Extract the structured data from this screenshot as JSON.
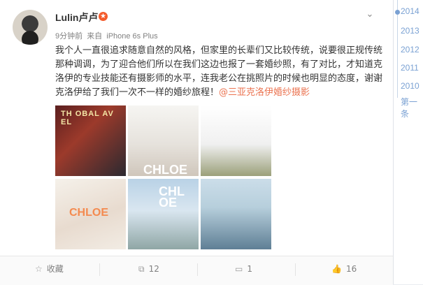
{
  "post": {
    "username": "Lulin卢卢",
    "vip_badge_icon": "star-icon",
    "time": "9分钟前",
    "source_prefix": "来自",
    "device": "iPhone 6s Plus",
    "text": "我个人一直很追求随意自然的风格，但家里的长辈们又比较传统，说要很正规传统那种调调，为了迎合他们所以在我们这边也报了一套婚纱照，有了对比，才知道克洛伊的专业技能还有摄影师的水平，连我老公在挑照片的时候也明显的态度，谢谢克洛伊给了我们一次不一样的婚纱旅程！",
    "mention": "@三亚克洛伊婚纱摄影",
    "thumbs": [
      {
        "label": "TH OBAL AV EL"
      },
      {
        "label": "CHLOE"
      },
      {
        "label": ""
      },
      {
        "label": "CHLOE"
      },
      {
        "label": "CHL OE"
      },
      {
        "label": ""
      }
    ]
  },
  "actions": {
    "favorite_label": "收藏",
    "repost_count": "12",
    "comment_count": "1",
    "like_count": "16"
  },
  "timeline": {
    "years": [
      "2014",
      "2013",
      "2012",
      "2011",
      "2010"
    ],
    "first_label": "第一条"
  },
  "colors": {
    "mention": "#eb7350",
    "timeline": "#7aa1d3",
    "badge": "#f45b2b"
  }
}
